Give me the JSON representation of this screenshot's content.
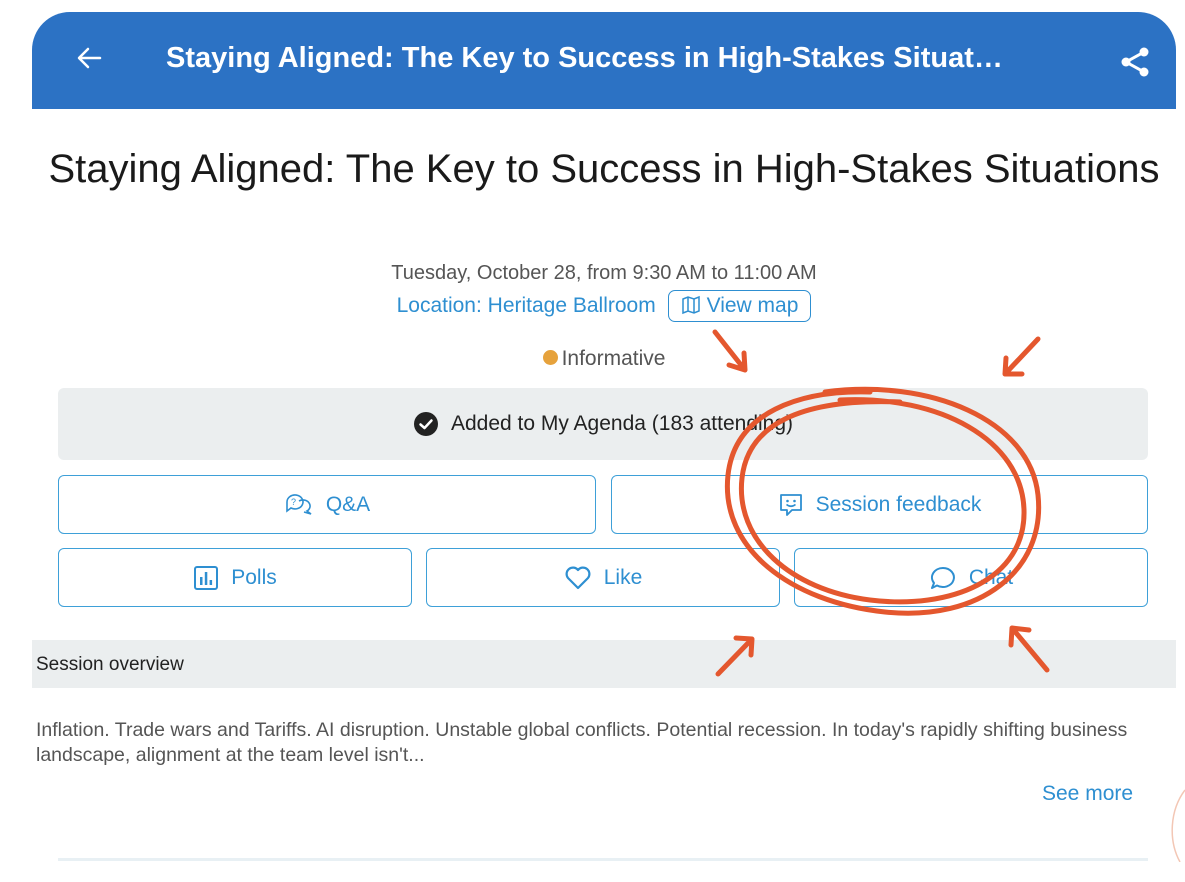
{
  "app_bar": {
    "title": "Staying Aligned: The Key to Success in High-Stakes Situat…"
  },
  "session": {
    "title": "Staying Aligned: The Key to Success in High-Stakes Situations",
    "time": "Tuesday, October 28, from 9:30 AM to 11:00 AM",
    "location": "Location: Heritage Ballroom",
    "view_map_label": "View map",
    "tag": "Informative",
    "tag_color": "#e6a23c"
  },
  "agenda": {
    "status": "Added to My Agenda (183 attending)"
  },
  "actions": {
    "qa_label": "Q&A",
    "feedback_label": "Session feedback",
    "polls_label": "Polls",
    "like_label": "Like",
    "chat_label": "Chat"
  },
  "overview": {
    "header": "Session overview",
    "text": "Inflation. Trade wars and Tariffs. AI disruption. Unstable global conflicts. Potential recession. In today's rapidly shifting business landscape, alignment at the team level isn't...",
    "see_more": "See more"
  },
  "colors": {
    "app_bar": "#2c72c4",
    "accent": "#2e8fd1",
    "annotation": "#e4572e"
  },
  "icons": [
    "back-arrow-icon",
    "share-icon",
    "map-icon",
    "check-circle-icon",
    "qa-icon",
    "feedback-icon",
    "polls-icon",
    "heart-icon",
    "chat-icon"
  ]
}
